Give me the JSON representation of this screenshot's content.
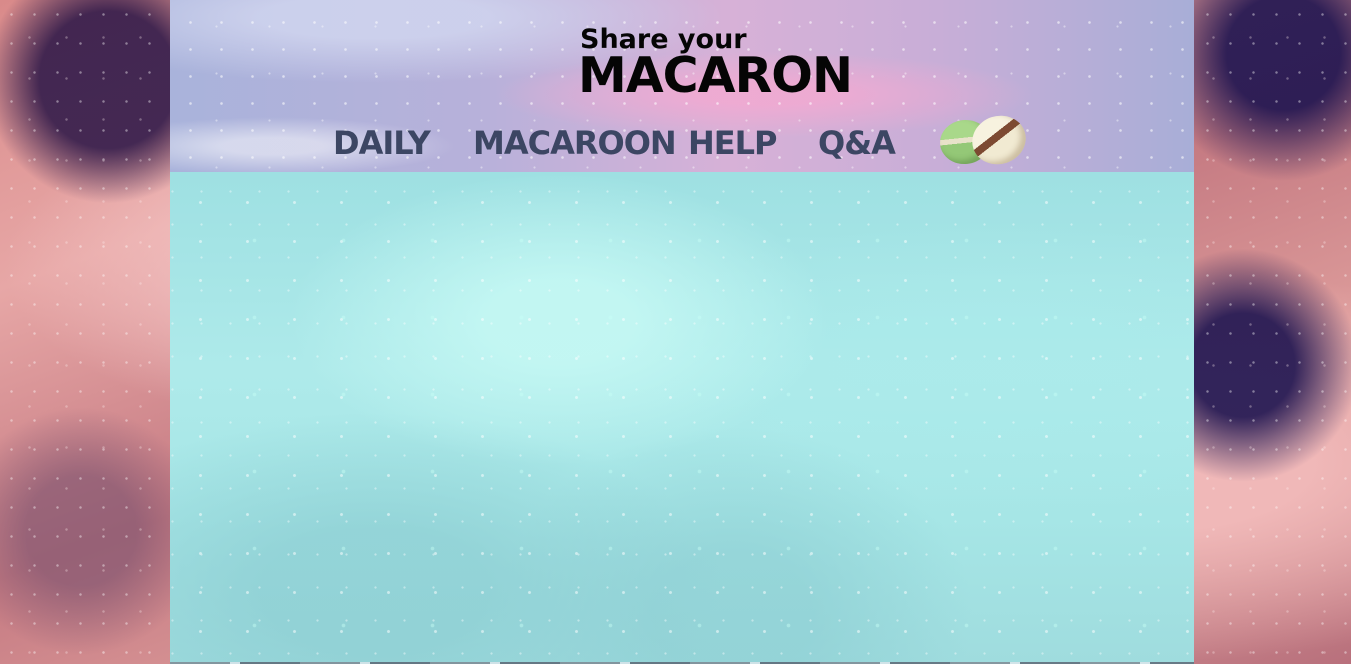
{
  "logo": {
    "line1": "Share your",
    "line2": "MACARON"
  },
  "nav": {
    "items": [
      {
        "label": "DAILY"
      },
      {
        "label": "MACAROON"
      },
      {
        "label": "HELP"
      },
      {
        "label": "Q&A"
      }
    ]
  },
  "icons": {
    "macarons": "macaron-image"
  },
  "colors": {
    "nav_text": "#3c4663",
    "logo_text": "#050505",
    "content_bg": "#a6e6e6",
    "header_bg": "#b7b1da"
  }
}
